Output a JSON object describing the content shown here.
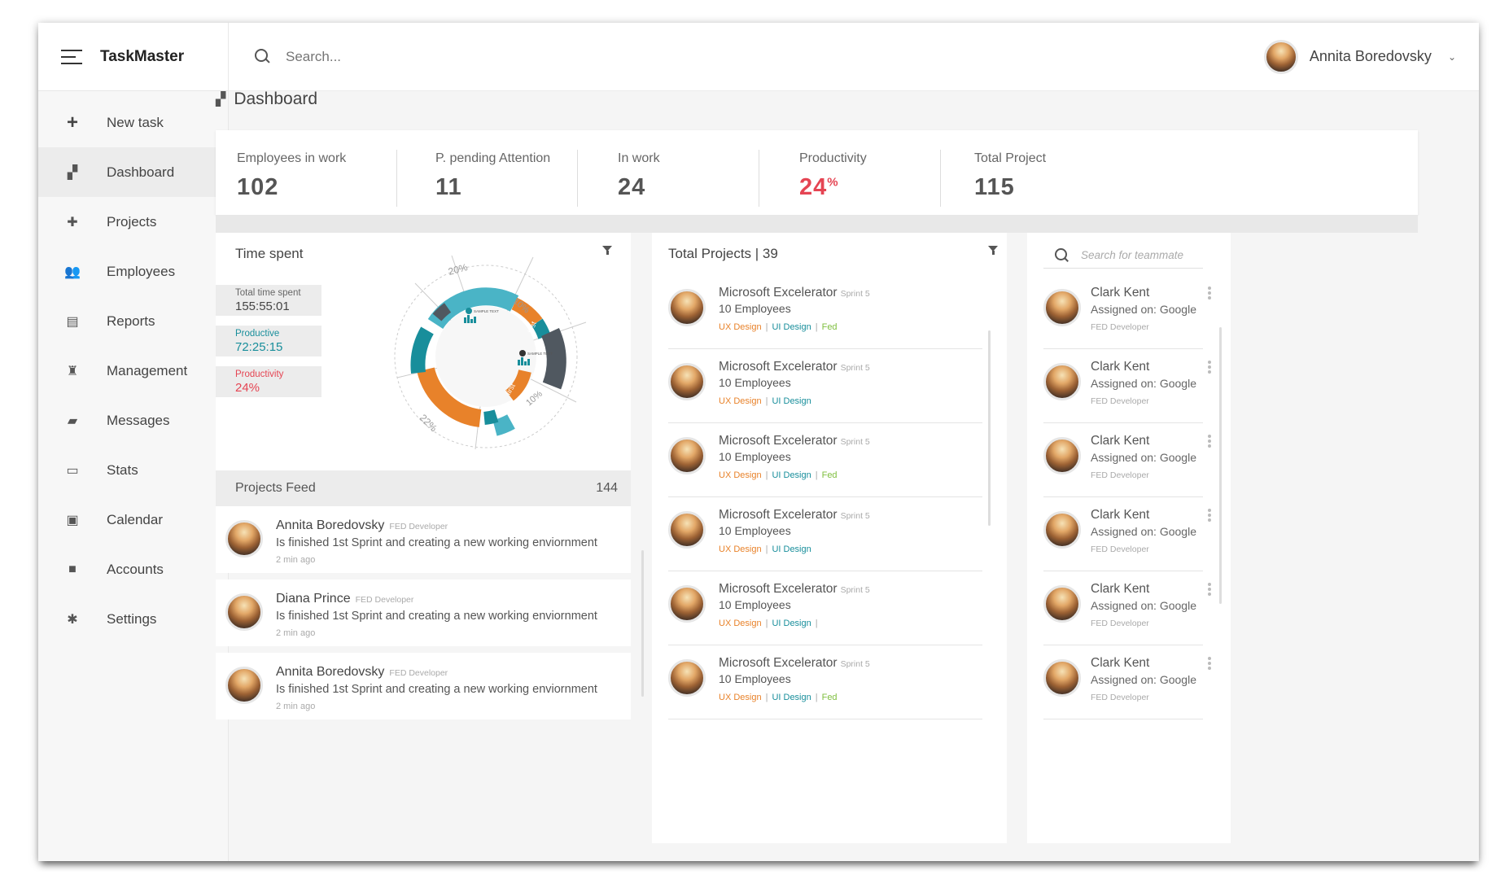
{
  "app": {
    "brand": "TaskMaster"
  },
  "search": {
    "placeholder": "Search..."
  },
  "user": {
    "name": "Annita Boredovsky"
  },
  "sidebar": {
    "items": [
      {
        "label": "New task",
        "icon": "plus-icon"
      },
      {
        "label": "Dashboard",
        "icon": "dashboard-icon",
        "active": true
      },
      {
        "label": "Projects",
        "icon": "puzzle-icon"
      },
      {
        "label": "Employees",
        "icon": "people-icon"
      },
      {
        "label": "Reports",
        "icon": "reports-icon"
      },
      {
        "label": "Management",
        "icon": "tie-icon"
      },
      {
        "label": "Messages",
        "icon": "chat-icon"
      },
      {
        "label": "Stats",
        "icon": "monitor-icon"
      },
      {
        "label": "Calendar",
        "icon": "calendar-icon"
      },
      {
        "label": "Accounts",
        "icon": "briefcase-icon"
      },
      {
        "label": "Settings",
        "icon": "gear-icon"
      }
    ]
  },
  "page": {
    "title": "Dashboard"
  },
  "stats": [
    {
      "label": "Employees in work",
      "value": "102"
    },
    {
      "label": "P. pending Attention",
      "value": "11"
    },
    {
      "label": "In work",
      "value": "24"
    },
    {
      "label": "Productivity",
      "value": "24",
      "unit": "%",
      "color": "#e54553"
    },
    {
      "label": "Total Project",
      "value": "115"
    }
  ],
  "time_spent": {
    "title": "Time spent",
    "total_label": "Total time spent",
    "total_value": "155:55:01",
    "productive_label": "Productive",
    "productive_value": "72:25:15",
    "productivity_label": "Productivity",
    "productivity_value": "24%",
    "chart_labels": [
      "20%",
      "10%",
      "10%",
      "22%",
      "first",
      "first"
    ],
    "sample_text": "SAMPLE TEXT",
    "colors": {
      "teal": "#188e9b",
      "cyan": "#4ab4c6",
      "orange": "#e8822a",
      "dark": "#505860"
    }
  },
  "feed": {
    "title": "Projects Feed",
    "count": "144",
    "items": [
      {
        "name": "Annita Boredovsky",
        "role": "FED Developer",
        "text": "Is finished 1st Sprint and creating a new working enviornment",
        "time": "2 min ago"
      },
      {
        "name": "Diana Prince",
        "role": "FED Developer",
        "text": "Is finished 1st Sprint and creating a new working enviornment",
        "time": "2 min ago"
      },
      {
        "name": "Annita Boredovsky",
        "role": "FED Developer",
        "text": "Is finished 1st Sprint and creating a new working enviornment",
        "time": "2 min ago"
      }
    ]
  },
  "projects": {
    "title": "Total Projects",
    "count": "| 39",
    "items": [
      {
        "name": "Microsoft Excelerator",
        "sprint": "Sprint 5",
        "employees": "10 Employees",
        "tags": [
          "UX Design",
          "UI Design",
          "Fed"
        ]
      },
      {
        "name": "Microsoft Excelerator",
        "sprint": "Sprint 5",
        "employees": "10 Employees",
        "tags": [
          "UX Design",
          "UI Design"
        ]
      },
      {
        "name": "Microsoft Excelerator",
        "sprint": "Sprint 5",
        "employees": "10 Employees",
        "tags": [
          "UX Design",
          "UI Design",
          "Fed"
        ]
      },
      {
        "name": "Microsoft Excelerator",
        "sprint": "Sprint 5",
        "employees": "10 Employees",
        "tags": [
          "UX Design",
          "UI Design"
        ]
      },
      {
        "name": "Microsoft Excelerator",
        "sprint": "Sprint 5",
        "employees": "10 Employees",
        "tags": [
          "UX Design",
          "UI Design",
          ""
        ]
      },
      {
        "name": "Microsoft Excelerator",
        "sprint": "Sprint 5",
        "employees": "10 Employees",
        "tags": [
          "UX Design",
          "UI Design",
          "Fed"
        ]
      }
    ]
  },
  "team": {
    "search_placeholder": "Search for teammate",
    "items": [
      {
        "name": "Clark Kent",
        "assigned": "Assigned on: Google",
        "role": "FED Developer"
      },
      {
        "name": "Clark Kent",
        "assigned": "Assigned on: Google",
        "role": "FED Developer"
      },
      {
        "name": "Clark Kent",
        "assigned": "Assigned on: Google",
        "role": "FED Developer"
      },
      {
        "name": "Clark Kent",
        "assigned": "Assigned on: Google",
        "role": "FED Developer"
      },
      {
        "name": "Clark Kent",
        "assigned": "Assigned on: Google",
        "role": "FED Developer"
      },
      {
        "name": "Clark Kent",
        "assigned": "Assigned on: Google",
        "role": "FED Developer"
      }
    ]
  }
}
